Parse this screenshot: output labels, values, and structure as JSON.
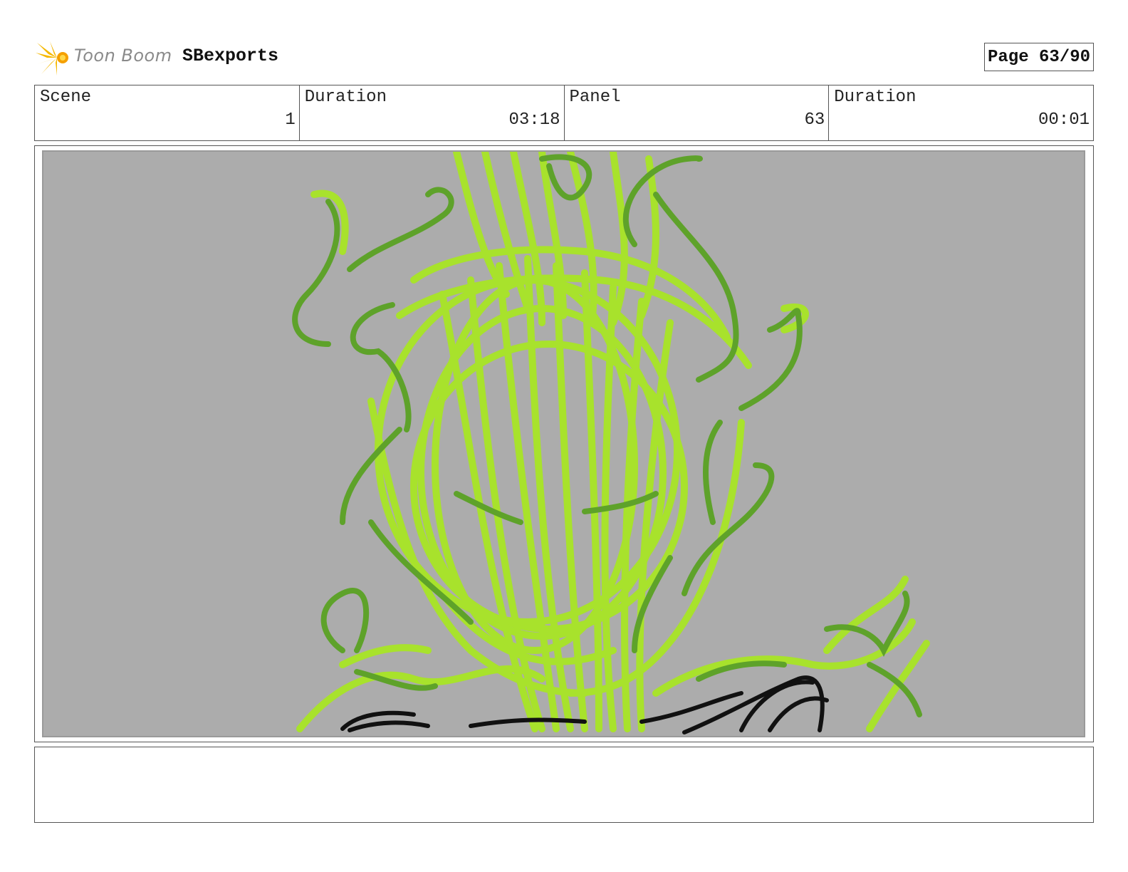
{
  "header": {
    "logo_text": "Toon Boom",
    "project_name": "SBexports",
    "page_label": "Page 63/90"
  },
  "info": {
    "scene_label": "Scene",
    "scene_value": "1",
    "scene_duration_label": "Duration",
    "scene_duration_value": "03:18",
    "panel_label": "Panel",
    "panel_value": "63",
    "panel_duration_label": "Duration",
    "panel_duration_value": "00:01"
  },
  "colors": {
    "canvas_bg": "#acacac",
    "light_green": "#a8e22c",
    "dark_green": "#5ea22a",
    "ink": "#111111"
  },
  "notes": {
    "text": ""
  }
}
